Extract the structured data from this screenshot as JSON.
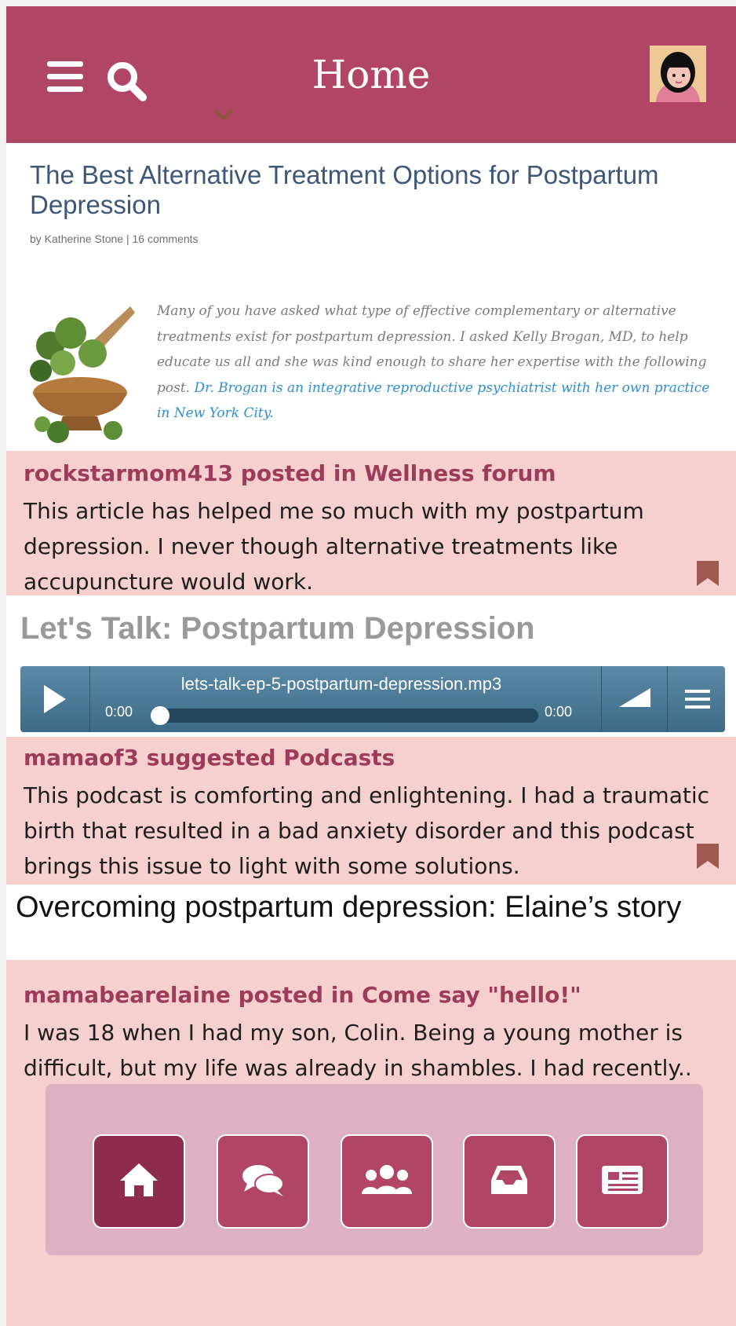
{
  "header": {
    "title": "Home",
    "menu_icon": "hamburger-menu-icon",
    "search_icon": "search-icon",
    "avatar": "user-avatar",
    "accent_color": "#b14565"
  },
  "article": {
    "title": "The Best Alternative Treatment Options for Postpartum Depression",
    "byline": "by Katherine Stone | 16 comments",
    "excerpt": "Many of you have asked what type of effective complementary or alternative treatments exist for postpartum depression. I asked Kelly Brogan, MD, to help educate us all and she was kind enough to share her expertise with the following post.",
    "excerpt_link": "Dr. Brogan is an integrative reproductive psychiatrist with her own practice in New York City."
  },
  "posts": [
    {
      "header": "rockstarmom413 posted in Wellness forum",
      "body": "This article has helped me so much with my postpartum depression. I never though alternative treatments like accupuncture would work."
    },
    {
      "header": "mamaof3 suggested Podcasts",
      "body": "This podcast is comforting and enlightening. I had a traumatic birth that resulted in a bad anxiety disorder and this podcast brings this issue to light with some solutions."
    },
    {
      "header": "mamabearelaine posted in Come say \"hello!\"",
      "body": "I was 18 when I had my son, Colin. Being a young mother is difficult, but my life was already in shambles. I had recently.."
    }
  ],
  "podcast": {
    "title": "Let's Talk: Postpartum Depression",
    "filename": "lets-talk-ep-5-postpartum-depression.mp3",
    "current_time": "0:00",
    "duration": "0:00"
  },
  "story": {
    "title": "Overcoming postpartum depression: Elaine’s story"
  },
  "bottom_nav": [
    {
      "icon": "home-icon",
      "active": true
    },
    {
      "icon": "chat-icon",
      "active": false
    },
    {
      "icon": "community-icon",
      "active": false
    },
    {
      "icon": "inbox-icon",
      "active": false
    },
    {
      "icon": "news-icon",
      "active": false
    }
  ]
}
